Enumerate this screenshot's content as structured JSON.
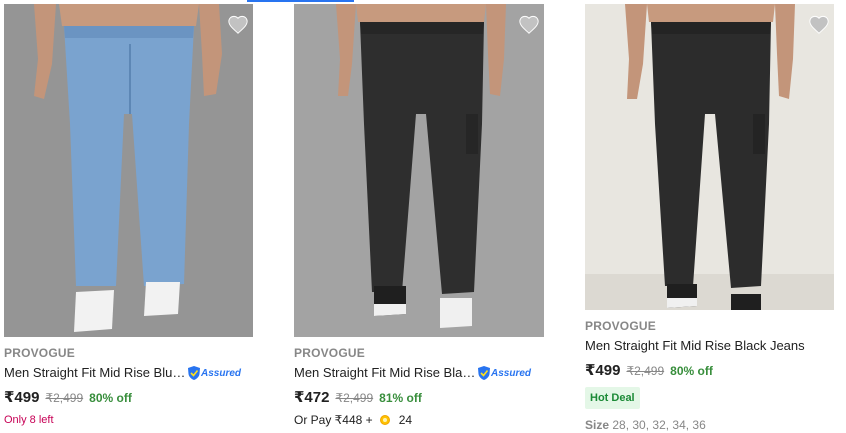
{
  "colors": {
    "accent": "#2874f0",
    "discount": "#388e3c",
    "stock": "#c70055",
    "hot_deal_bg": "#e4f7e7"
  },
  "products": [
    {
      "brand": "PROVOGUE",
      "title": "Men Straight Fit Mid Rise Blue Jeans",
      "assured": "Assured",
      "price": "₹499",
      "mrp": "₹2,499",
      "discount": "80% off",
      "extra": "Only 8 left",
      "jeans_color": "light-blue"
    },
    {
      "brand": "PROVOGUE",
      "title": "Men Straight Fit Mid Rise Black Jeans",
      "assured": "Assured",
      "price": "₹472",
      "mrp": "₹2,499",
      "discount": "81% off",
      "or_pay": "Or Pay ₹448 +",
      "coins": "24",
      "jeans_color": "black"
    },
    {
      "brand": "PROVOGUE",
      "title": "Men Straight Fit Mid Rise Black Jeans",
      "price": "₹499",
      "mrp": "₹2,499",
      "discount": "80% off",
      "badge": "Hot Deal",
      "sizes_label": "Size",
      "sizes": "28, 30, 32, 34, 36",
      "jeans_color": "black"
    }
  ]
}
